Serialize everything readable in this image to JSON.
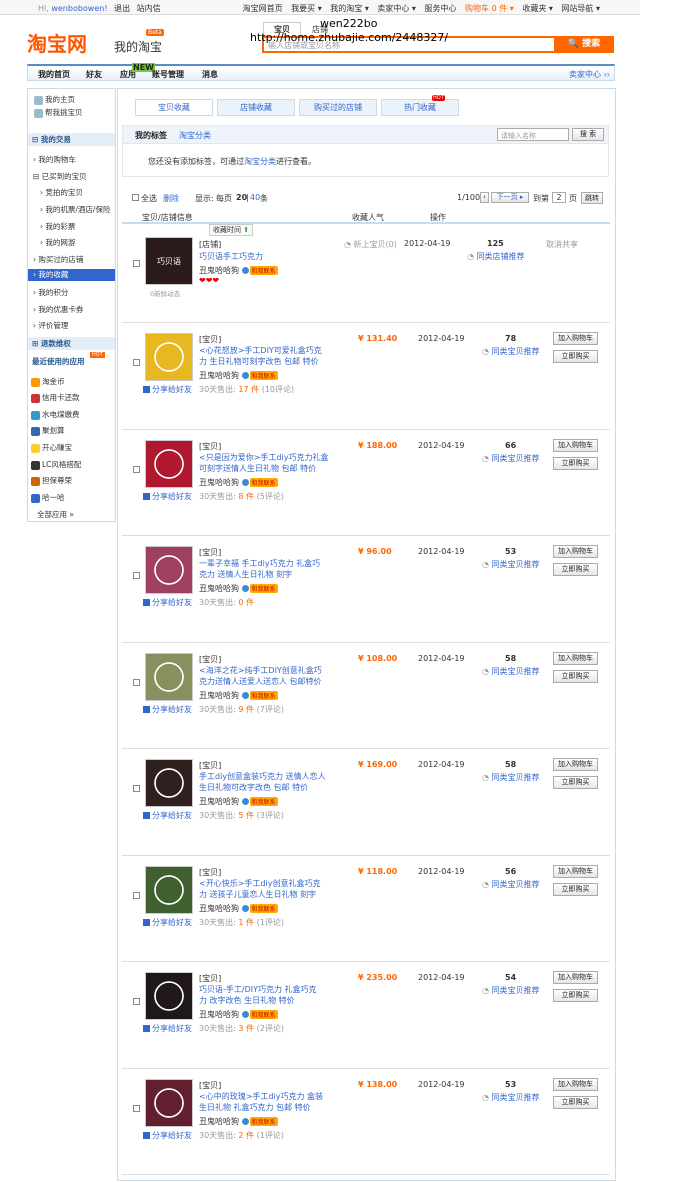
{
  "topbar": {
    "hi": "Hi,",
    "user": "wenbobowen!",
    "logout": "退出",
    "msg": "站内信",
    "links": [
      "淘宝网首页",
      "我要买 ▾",
      "我的淘宝 ▾",
      "卖家中心 ▾",
      "服务中心",
      "购物车 0 件 ▾",
      "收藏夹 ▾",
      "网站导航 ▾"
    ]
  },
  "header": {
    "logo": "淘宝网",
    "mytaobao": "我的淘宝",
    "beta": "Beta",
    "search_tabs": [
      "宝贝",
      "店铺"
    ],
    "search_placeholder": "输入店铺或宝贝名称",
    "search_btn": "🔍 搜索"
  },
  "watermark": {
    "line1": "wen222bo",
    "line2": "http://home.zhubajie.com/2448327/"
  },
  "nav": {
    "items": [
      "我的首页",
      "好友",
      "应用",
      "账号管理",
      "消息"
    ],
    "new_badge": "NEW",
    "seller": "卖家中心 ››"
  },
  "sidebar": {
    "top": [
      "我的主页",
      "帮我挑宝贝"
    ],
    "trade_head": "我的交易",
    "trade": [
      "我的购物车",
      "已买到的宝贝",
      "竞拍的宝贝",
      "我的机票/酒店/保险",
      "我的彩票",
      "我的网游",
      "购买过的店铺",
      "我的收藏",
      "我的积分",
      "我的优惠卡券",
      "评价管理"
    ],
    "refund": "退款维权",
    "apps_head": "最近使用的应用",
    "apps": [
      "淘金币",
      "信用卡还款",
      "水电煤缴费",
      "聚划算",
      "开心赚宝",
      "LC风格搭配",
      "担保尊荣",
      "哈一哈"
    ],
    "all": "全部应用 »"
  },
  "tabs": [
    "宝贝收藏",
    "店铺收藏",
    "购买过的店铺",
    "热门收藏"
  ],
  "hot_badge": "HOT",
  "tagbox": {
    "my_tags": "我的标签",
    "category": "淘宝分类",
    "search_placeholder": "请输入名称",
    "search_btn": "搜 索",
    "empty_prefix": "您还没有添加标签，可通过",
    "empty_link": "淘宝分类",
    "empty_suffix": "进行查看。"
  },
  "toolbar": {
    "select_all": "全选",
    "delete": "删除",
    "display": "显示:",
    "per_page": "每页",
    "n20": "20",
    "n40": "40",
    "unit": "条",
    "page": "1/100",
    "next": "下一页 ▸",
    "goto": "到第",
    "page_val": "2",
    "page_unit": "页",
    "jump": "跳转"
  },
  "header_row": {
    "item": "宝贝/店铺信息",
    "pop": "收藏人气",
    "op": "操作",
    "time_tip": "收藏时间"
  },
  "shop_row": {
    "type": "[店铺]",
    "name": "巧贝语手工巧克力",
    "seller": "丑鬼哈哈狗",
    "contact": "和我联系",
    "new": "新上宝贝(0)",
    "date": "2012-04-19",
    "count": "125",
    "rec": "同类店铺推荐",
    "cancel": "取消共享",
    "thumb": "巧贝语",
    "dyn": "0新鲜动态"
  },
  "common": {
    "type": "[宝贝]",
    "seller": "丑鬼哈哈狗",
    "contact": "和我联系",
    "share": "分享给好友",
    "sold": "30天售出:",
    "rec": "同类宝贝推荐",
    "cart": "加入购物车",
    "buy": "立即购买",
    "date": "2012-04-19"
  },
  "items": [
    {
      "title1": "<心花怒放>手工DIY可爱礼盒巧克",
      "title2": "力 生日礼物可刻字改色 包邮 特价",
      "price": "¥ 131.40",
      "count": "78",
      "sold": "17 件",
      "reviews": "(10评论)",
      "color": "#e8b820"
    },
    {
      "title1": "<只是因为爱你>手工diy巧克力礼盒",
      "title2": "可刻字送情人生日礼物 包邮 特价",
      "price": "¥ 188.00",
      "count": "66",
      "sold": "8 件",
      "reviews": "(5评论)",
      "color": "#b01830"
    },
    {
      "title1": "一辈子幸福 手工diy巧克力 礼盒巧",
      "title2": "克力 送情人生日礼物 刻字",
      "price": "¥ 96.00",
      "count": "53",
      "sold": "0 件",
      "reviews": "",
      "color": "#a04060"
    },
    {
      "title1": "<海洋之花>纯手工DIY创意礼盒巧",
      "title2": "克力送情人送爱人送恋人 包邮特价",
      "price": "¥ 108.00",
      "count": "58",
      "sold": "9 件",
      "reviews": "(7评论)",
      "color": "#889060"
    },
    {
      "title1": "手工diy创意盒装巧克力 送情人恋人",
      "title2": "生日礼物可改字改色 包邮 特价",
      "price": "¥ 169.00",
      "count": "58",
      "sold": "5 件",
      "reviews": "(3评论)",
      "color": "#302020"
    },
    {
      "title1": "<开心快乐>手工diy创意礼盒巧克",
      "title2": "力 送孩子儿童恋人生日礼物 刻字",
      "price": "¥ 118.00",
      "count": "56",
      "sold": "1 件",
      "reviews": "(1评论)",
      "color": "#406030"
    },
    {
      "title1": "巧贝语-手工/DIY巧克力 礼盒巧克",
      "title2": "力 改字改色 生日礼物 特价",
      "price": "¥ 235.00",
      "count": "54",
      "sold": "3 件",
      "reviews": "(2评论)",
      "color": "#201818"
    },
    {
      "title1": "<心中的玫瑰>手工diy巧克力 盒装",
      "title2": "生日礼物 礼盒巧克力 包邮 特价",
      "price": "¥ 138.00",
      "count": "53",
      "sold": "2 件",
      "reviews": "(1评论)",
      "color": "#602030"
    }
  ],
  "colors": {
    "accent": "#ff6600",
    "link": "#3366cc",
    "border": "#c7dcec"
  }
}
